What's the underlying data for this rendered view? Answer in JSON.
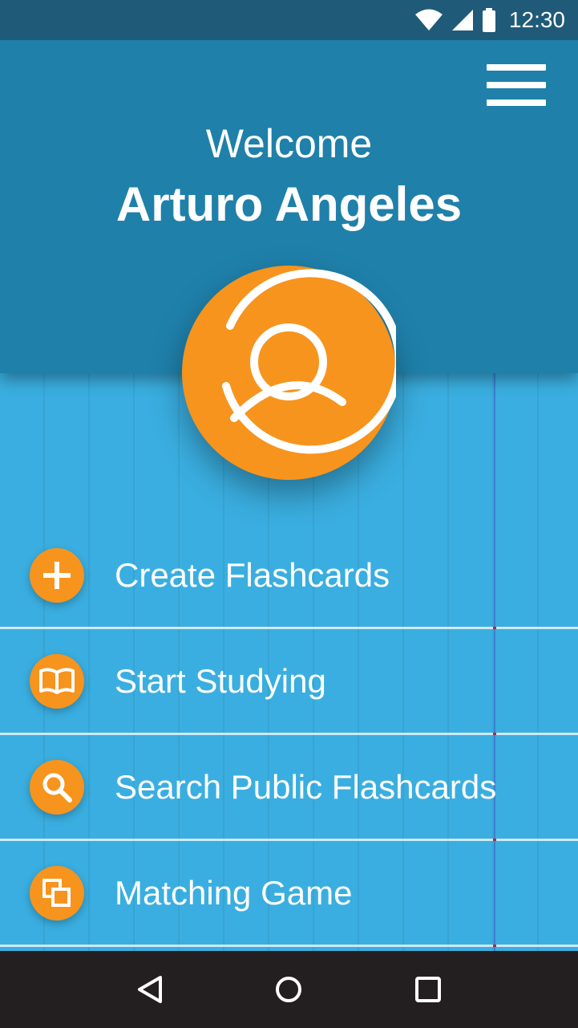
{
  "status_bar": {
    "time": "12:30",
    "icons": [
      "wifi-icon",
      "signal-icon",
      "battery-icon"
    ]
  },
  "header": {
    "menu_icon": "hamburger-menu-icon",
    "welcome": "Welcome",
    "user_name": "Arturo Angeles",
    "avatar_icon": "user-profile-icon"
  },
  "menu": {
    "items": [
      {
        "label": "Create Flashcards",
        "icon": "plus-icon"
      },
      {
        "label": "Start Studying",
        "icon": "book-icon"
      },
      {
        "label": "Search Public Flashcards",
        "icon": "search-icon"
      },
      {
        "label": "Matching Game",
        "icon": "copy-cards-icon"
      }
    ]
  },
  "nav_bar": {
    "buttons": [
      "back-icon",
      "home-icon",
      "recents-icon"
    ]
  },
  "colors": {
    "header_bg": "#1f80aa",
    "status_bg": "#1f5a78",
    "page_bg": "#3aaee0",
    "accent_orange": "#f7941d",
    "nav_bg": "#231f20"
  }
}
